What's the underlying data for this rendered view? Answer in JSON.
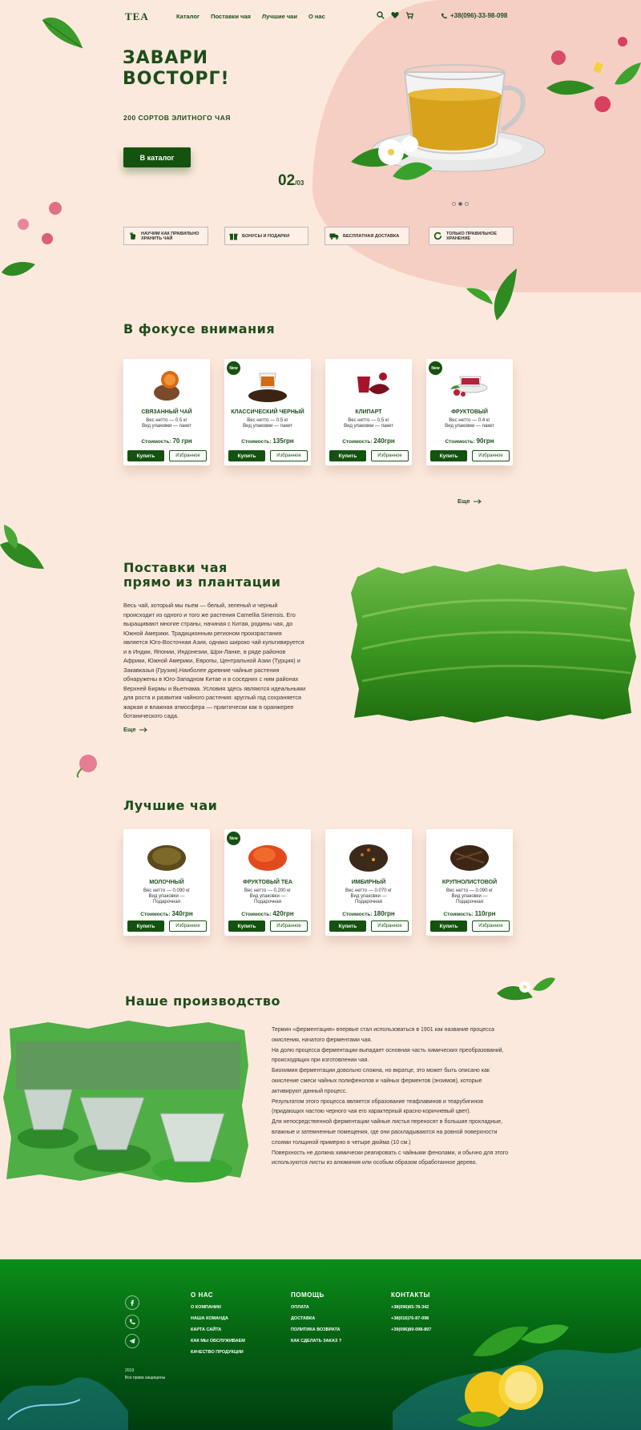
{
  "header": {
    "logo": "TEA",
    "nav": [
      "Каталог",
      "Поставки чая",
      "Лучшие чаи",
      "О нас"
    ],
    "phone": "+38(096)-33-98-098"
  },
  "hero": {
    "title_line1": "ЗАВАРИ",
    "title_line2": "ВОСТОРГ!",
    "subtitle": "200 СОРТОВ ЭЛИТНОГО ЧАЯ",
    "button": "В каталог",
    "slide_current": "02",
    "slide_total": "/03"
  },
  "features": [
    {
      "line1": "НАУЧИМ КАК ПРАВИЛЬНО",
      "line2": "ХРАНИТЬ ЧАЙ",
      "icon": "hand-icon"
    },
    {
      "line1": "БОНУСЫ И ПОДАРКИ",
      "line2": "",
      "icon": "gift-icon"
    },
    {
      "line1": "БЕСПЛАТНАЯ ДОСТАВКА",
      "line2": "",
      "icon": "truck-icon"
    },
    {
      "line1": "ТОЛЬКО ПРАВИЛЬНОЕ",
      "line2": "ХРАНЕНИЕ",
      "icon": "refresh-icon"
    }
  ],
  "focus": {
    "title": "В фокусе внимания",
    "more": "Еще",
    "cards": [
      {
        "badge": "",
        "name": "СВЯЗАННЫЙ ЧАЙ",
        "meta1": "Вес нетто — 0.5 кг",
        "meta2": "Вид упаковки — пакет",
        "meta3": "",
        "price_label": "Стоимость:",
        "price": "70 грн"
      },
      {
        "badge": "New",
        "name": "КЛАССИЧЕСКИЙ ЧЕРНЫЙ",
        "meta1": "Вес нетто — 0.5 кг",
        "meta2": "Вид упаковки — пакет",
        "meta3": "",
        "price_label": "Стоимость:",
        "price": "135грн"
      },
      {
        "badge": "",
        "name": "КЛИПАРТ",
        "meta1": "Вес нетто — 0.5 кг",
        "meta2": "Вид упаковки — пакет",
        "meta3": "",
        "price_label": "Стоимость:",
        "price": "240грн"
      },
      {
        "badge": "New",
        "name": "ФРУКТОВЫЙ",
        "meta1": "Вес нетто — 0.4 кг",
        "meta2": "Вид упаковки — пакет",
        "meta3": "",
        "price_label": "Стоимость:",
        "price": "90грн"
      }
    ],
    "buy": "Купить",
    "fav": "Избранное"
  },
  "supply": {
    "title_line1": "Поставки чая",
    "title_line2": "прямо из плантации",
    "text": "Весь чай, который мы пьем — белый, зеленый и черный происходит из одного и того же растения Camellia Sinensis. Его выращивают многие страны, начиная с Китая, родины чая, до Южной Америки. Традиционным регионом произрастания является Юго-Восточная Азия, однако широко чай культивируется и в Индии, Японии, Индонезии, Шри-Ланке, в ряде районов Африки, Южной Америки, Европы, Центральной Азии (Турция) и Закавказья (Грузия).Наиболее древние чайные растения обнаружены в Юго-Западном Китае и в соседних с ним районах Верхней Бирмы и Вьетнама. Условия здесь являются идеальными для роста и развития чайного растения: круглый год сохраняется жаркая и влажная атмосфера — практически как в оранжерее ботанического сада.",
    "more": "Еще"
  },
  "best": {
    "title": "Лучшие чаи",
    "cards": [
      {
        "badge": "",
        "name": "МОЛОЧНЫЙ",
        "meta1": "Вес нетто — 0.090 кг",
        "meta2": "Вид упаковки —",
        "meta3": "Подарочная",
        "price_label": "Стоимость:",
        "price": "340грн"
      },
      {
        "badge": "New",
        "name": "ФРУКТОВЫЙ TEA",
        "meta1": "Вес нетто — 0.200 кг",
        "meta2": "Вид упаковки —",
        "meta3": "Подарочная",
        "price_label": "Стоимость:",
        "price": "420грн"
      },
      {
        "badge": "",
        "name": "ИМБИРНЫЙ",
        "meta1": "Вес нетто — 0.070 кг",
        "meta2": "Вид упаковки —",
        "meta3": "Подарочная",
        "price_label": "Стоимость:",
        "price": "180грн"
      },
      {
        "badge": "",
        "name": "КРУПНОЛИСТОВОЙ",
        "meta1": "Вес нетто — 0.090 кг",
        "meta2": "Вид упаковки —",
        "meta3": "Подарочная",
        "price_label": "Стоимость:",
        "price": "110грн"
      }
    ]
  },
  "production": {
    "title": "Наше производство",
    "text": "Термин «ферментация» впервые стал использоваться в 1901 как название процесса окисления, начатого ферментами чая.\nНа долю процесса ферментации выпадает основная часть химических преобразований, происходящих при изготовлении чая.\nБиохимия ферментации довольно сложна, но вкратце, это может быть описано как окисление смеси чайных полифенолов и чайных ферментов (энзимов), которые активируют данный процесс.\nРезультатом этого процесса является образование теафлавинов и теарубигинов (придающих настою черного чая его характерный красно-коричневый цвет).\nДля непосредственной ферментации чайные листья переносят в большие прохладные, влажные и затемненные помещения, где они раскладываются на ровной поверхности слоями толщиной примерно в четыре дюйма (10 см.)\nПоверхность не должна химически реагировать с чайными фенолами, и обычно для этого используются листы из алюминия или особым образом обработанное дерево."
  },
  "footer": {
    "about_title": "О НАС",
    "about_links": [
      "О КОМПАНИИ",
      "НАША КОМАНДА",
      "КАРТА САЙТА",
      "КАК МЫ ОБСЛУЖИВАЕМ",
      "КАЧЕСТВО ПРОДУКЦИИ"
    ],
    "help_title": "ПОМОЩЬ",
    "help_links": [
      "ОПЛАТА",
      "ДОСТАВКА",
      "ПОЛИТИКА ВОЗВРАТА",
      "КАК СДЕЛАТЬ ЗАКАЗ ?"
    ],
    "contacts_title": "КОНТАКТЫ",
    "phones": [
      "+38(096)65-78-342",
      "+38(016)76-87-098",
      "+39(096)89-098-897"
    ],
    "year": "2019",
    "rights": "Все права защищены"
  },
  "colors": {
    "brand": "#155210",
    "bg": "#fce9dd",
    "accent_pink": "#f6cfc4"
  }
}
